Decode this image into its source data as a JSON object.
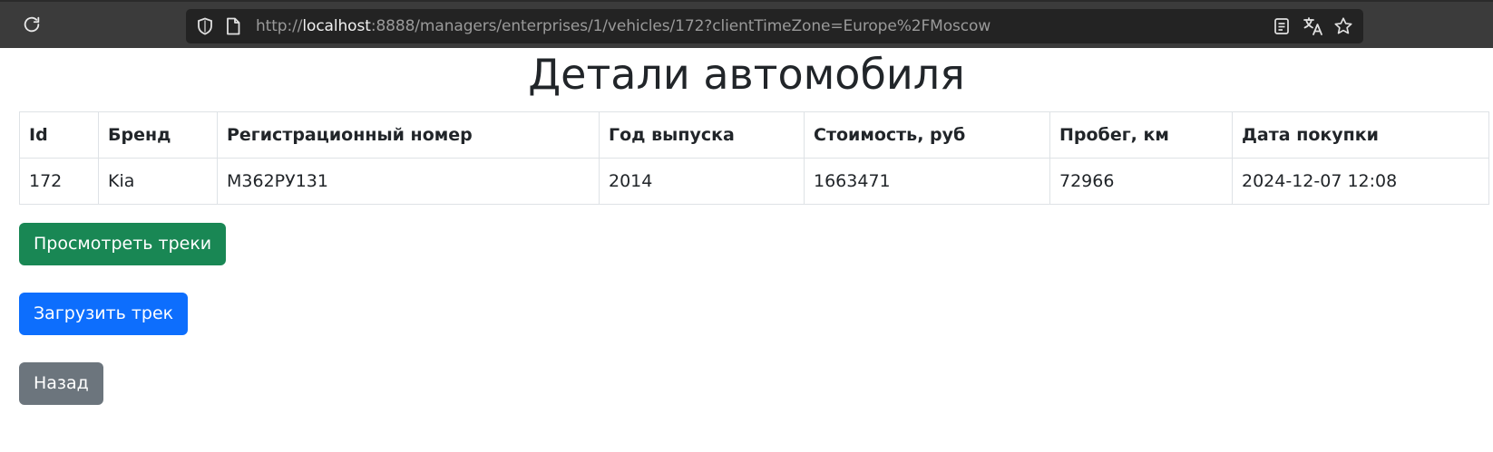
{
  "browser": {
    "url_scheme": "http://",
    "url_host": "localhost",
    "url_rest": ":8888/managers/enterprises/1/vehicles/172?clientTimeZone=Europe%2FMoscow",
    "icons": {
      "reload": "reload-icon",
      "shield": "shield-icon",
      "page": "page-icon",
      "reader": "reader-view-icon",
      "translate": "translate-icon",
      "bookmark": "bookmark-star-icon"
    }
  },
  "page": {
    "title": "Детали автомобиля"
  },
  "table": {
    "headers": {
      "id": "Id",
      "brand": "Бренд",
      "reg_number": "Регистрационный номер",
      "year": "Год выпуска",
      "price": "Стоимость, руб",
      "mileage": "Пробег, км",
      "purchase_date": "Дата покупки"
    },
    "row": {
      "id": "172",
      "brand": "Kia",
      "reg_number": "М362РУ131",
      "year": "2014",
      "price": "1663471",
      "mileage": "72966",
      "purchase_date": "2024-12-07 12:08"
    }
  },
  "actions": {
    "view_tracks": "Просмотреть треки",
    "upload_track": "Загрузить трек",
    "back": "Назад"
  },
  "colors": {
    "toolbar": "#3b3b3b",
    "urlbar": "#232323",
    "success": "#198754",
    "primary": "#0d6efd",
    "secondary": "#6c757d"
  }
}
